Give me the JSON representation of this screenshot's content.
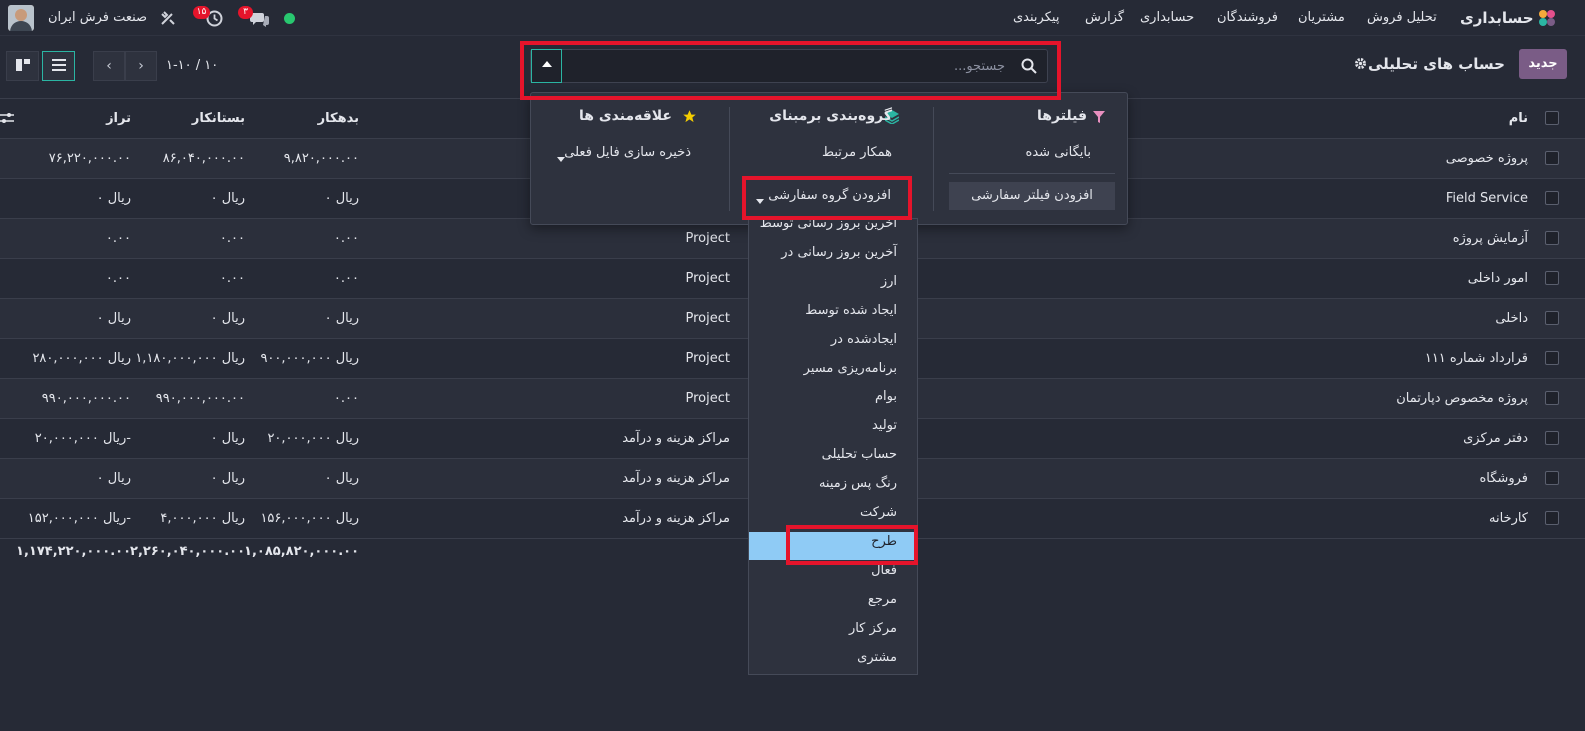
{
  "topbar": {
    "app": "حسابداری",
    "menu": [
      "تحلیل فروش",
      "مشتریان",
      "فروشندگان",
      "حسابداری",
      "گزارش",
      "پیکربندی"
    ],
    "company": "صنعت فرش ایران",
    "badge_messages": "۳",
    "badge_activity": "۱۵"
  },
  "control": {
    "new_label": "جدید",
    "title": "حساب های تحلیلی",
    "search_placeholder": "جستجو...",
    "pager": "۱-۱۰ / ۱۰"
  },
  "table": {
    "headers": {
      "name": "نام",
      "debit": "بدهکار",
      "credit": "بستانکار",
      "balance": "تراز"
    },
    "rows": [
      {
        "name": "پروژه خصوصی",
        "plan": "",
        "debit": "۹,۸۲۰,۰۰۰.۰۰",
        "credit": "۸۶,۰۴۰,۰۰۰.۰۰",
        "balance": "۷۶,۲۲۰,۰۰۰.۰۰"
      },
      {
        "name": "Field Service",
        "plan": "",
        "debit": "ریال ۰",
        "credit": "ریال ۰",
        "balance": "ریال ۰"
      },
      {
        "name": "آزمایش پروژه",
        "plan": "Project",
        "debit": "۰.۰۰",
        "credit": "۰.۰۰",
        "balance": "۰.۰۰"
      },
      {
        "name": "امور داخلی",
        "plan": "Project",
        "debit": "۰.۰۰",
        "credit": "۰.۰۰",
        "balance": "۰.۰۰"
      },
      {
        "name": "داخلی",
        "plan": "Project",
        "debit": "ریال ۰",
        "credit": "ریال ۰",
        "balance": "ریال ۰"
      },
      {
        "name": "قرارداد شماره ۱۱۱",
        "plan": "Project",
        "debit": "ریال ۹۰۰,۰۰۰,۰۰۰",
        "credit": "ریال ۱,۱۸۰,۰۰۰,۰۰۰",
        "balance": "ریال ۲۸۰,۰۰۰,۰۰۰"
      },
      {
        "name": "پروژه مخصوص دپارتمان",
        "plan": "Project",
        "debit": "۰.۰۰",
        "credit": "۹۹۰,۰۰۰,۰۰۰.۰۰",
        "balance": "۹۹۰,۰۰۰,۰۰۰.۰۰"
      },
      {
        "name": "دفتر مرکزی",
        "plan": "مراکز هزینه و درآمد",
        "debit": "ریال ۲۰,۰۰۰,۰۰۰",
        "credit": "ریال ۰",
        "balance": "ریال ۲۰,۰۰۰,۰۰۰-"
      },
      {
        "name": "فروشگاه",
        "plan": "مراکز هزینه و درآمد",
        "debit": "ریال ۰",
        "credit": "ریال ۰",
        "balance": "ریال ۰"
      },
      {
        "name": "کارخانه",
        "plan": "مراکز هزینه و درآمد",
        "debit": "ریال ۱۵۶,۰۰۰,۰۰۰",
        "credit": "ریال ۴,۰۰۰,۰۰۰",
        "balance": "ریال ۱۵۲,۰۰۰,۰۰۰-"
      }
    ],
    "totals": {
      "debit": "۱,۰۸۵,۸۲۰,۰۰۰.۰۰",
      "credit": "۲,۲۶۰,۰۴۰,۰۰۰.۰۰",
      "balance": "۱,۱۷۴,۲۲۰,۰۰۰.۰۰"
    }
  },
  "dropdown": {
    "filters_title": "فیلترها",
    "filters_item": "بایگانی شده",
    "add_filter": "افزودن فیلتر سفارشی",
    "groupby_title": "گروه‌بندی برمبنای",
    "groupby_item": "همکار مرتبط",
    "add_group": "افزودن گروه سفارشی",
    "fav_title": "علاقه‌مندی ها",
    "fav_item": "ذخیره سازی فایل فعلی",
    "options": [
      "آخرین بروز رسانی توسط",
      "آخرین بروز رسانی در",
      "ارز",
      "ایجاد شده توسط",
      "ایجادشده در",
      "برنامه‌ریزی مسیر",
      "بوام",
      "تولید",
      "حساب تحلیلی",
      "رنگ پس زمینه",
      "شرکت",
      "طرح",
      "فعال",
      "مرجع",
      "مرکز کار",
      "مشتری"
    ]
  },
  "colors": {
    "accent": "#2bb5a3",
    "brand": "#7a5c86",
    "highlight": "#e5142b",
    "selected": "#8fcbf5"
  }
}
